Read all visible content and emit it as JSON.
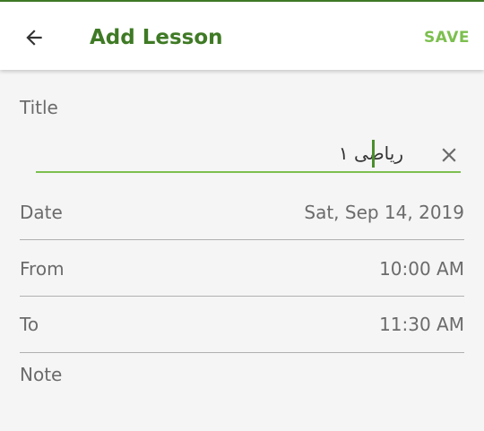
{
  "colors": {
    "accent": "#3f7a25",
    "accent_light": "#7cbf4e",
    "background": "#f5f5f5",
    "appbar": "#ffffff",
    "text_muted": "#6b6b6b",
    "divider": "#b0b0b0"
  },
  "appbar": {
    "back_icon": "arrow-left-icon",
    "title": "Add Lesson",
    "save_label": "SAVE"
  },
  "form": {
    "title": {
      "label": "Title",
      "value": "رياضی ۱",
      "clear_icon": "close-icon"
    },
    "date": {
      "label": "Date",
      "value": "Sat, Sep 14, 2019"
    },
    "from": {
      "label": "From",
      "value": "10:00 AM"
    },
    "to": {
      "label": "To",
      "value": "11:30 AM"
    },
    "note": {
      "label": "Note"
    }
  }
}
